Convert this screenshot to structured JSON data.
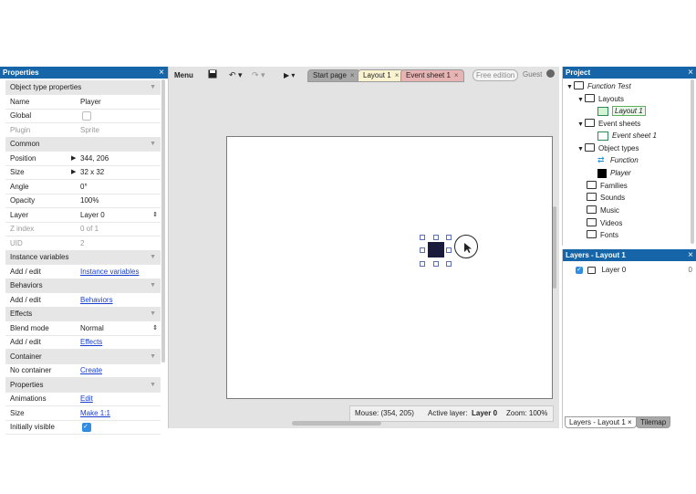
{
  "properties_panel": {
    "title": "Properties",
    "close": "×",
    "rows": [
      {
        "type": "section",
        "label": "Object type properties"
      },
      {
        "type": "row",
        "key": "Name",
        "value": "Player"
      },
      {
        "type": "check",
        "key": "Global",
        "checked": false
      },
      {
        "type": "row",
        "key": "Plugin",
        "value": "Sprite",
        "dim": true
      },
      {
        "type": "section",
        "label": "Common"
      },
      {
        "type": "row",
        "key": "Position",
        "value": "344, 206",
        "expand": true
      },
      {
        "type": "row",
        "key": "Size",
        "value": "32 x 32",
        "expand": true
      },
      {
        "type": "row",
        "key": "Angle",
        "value": "0°"
      },
      {
        "type": "row",
        "key": "Opacity",
        "value": "100%"
      },
      {
        "type": "select",
        "key": "Layer",
        "value": "Layer 0"
      },
      {
        "type": "row",
        "key": "Z index",
        "value": "0 of 1",
        "dim": true
      },
      {
        "type": "row",
        "key": "UID",
        "value": "2",
        "dim": true
      },
      {
        "type": "section",
        "label": "Instance variables"
      },
      {
        "type": "link",
        "key": "Add / edit",
        "value": "Instance variables"
      },
      {
        "type": "section",
        "label": "Behaviors"
      },
      {
        "type": "link",
        "key": "Add / edit",
        "value": "Behaviors"
      },
      {
        "type": "section",
        "label": "Effects"
      },
      {
        "type": "select",
        "key": "Blend mode",
        "value": "Normal"
      },
      {
        "type": "link",
        "key": "Add / edit",
        "value": "Effects"
      },
      {
        "type": "section",
        "label": "Container"
      },
      {
        "type": "link",
        "key": "No container",
        "value": "Create"
      },
      {
        "type": "section",
        "label": "Properties"
      },
      {
        "type": "link",
        "key": "Animations",
        "value": "Edit"
      },
      {
        "type": "link",
        "key": "Size",
        "value": "Make 1:1"
      },
      {
        "type": "check",
        "key": "Initially visible",
        "checked": true
      }
    ]
  },
  "toolbar": {
    "menu_label": "Menu",
    "tabs": [
      {
        "label": "Start page",
        "active": false
      },
      {
        "label": "Layout 1",
        "active": true
      },
      {
        "label": "Event sheet 1",
        "active": false
      }
    ],
    "edition_badge": "Free edition",
    "user_label": "Guest",
    "tab_close": "×"
  },
  "status": {
    "mouse_label": "Mouse: (354, 205)",
    "active_layer_label": "Active layer:",
    "active_layer_value": "Layer 0",
    "zoom_label": "Zoom: 100%"
  },
  "project_panel": {
    "title": "Project",
    "close": "×",
    "root": "Function Test",
    "layouts_folder": "Layouts",
    "layout_item": "Layout 1",
    "event_sheets_folder": "Event sheets",
    "event_sheet_item": "Event sheet 1",
    "object_types_folder": "Object types",
    "object_function": "Function",
    "object_player": "Player",
    "families": "Families",
    "sounds": "Sounds",
    "music": "Music",
    "videos": "Videos",
    "fonts": "Fonts"
  },
  "layers_panel": {
    "title": "Layers - Layout 1",
    "close": "×",
    "layer_name": "Layer 0",
    "layer_index": "0",
    "bottom_tab_layers": "Layers - Layout 1",
    "bottom_tab_tilemap": "Tilemap"
  }
}
